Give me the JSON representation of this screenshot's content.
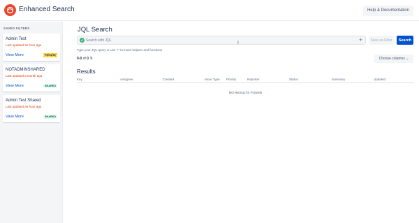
{
  "header": {
    "app_title": "Enhanced Search",
    "help_label": "Help & Documentation"
  },
  "sidebar": {
    "title": "SAVED FILTERS",
    "filters": [
      {
        "name": "Admin Test",
        "updated": "Last updated an hour ago",
        "link": "View More",
        "badge": "PRIVATE"
      },
      {
        "name": "NOTADMINSHARED",
        "updated": "Last updated a month ago",
        "link": "View More",
        "badge": "SHARED"
      },
      {
        "name": "Admin Test Shared",
        "updated": "Last updated an hour ago",
        "link": "View More",
        "badge": "SHARED"
      }
    ]
  },
  "main": {
    "title": "JQL Search",
    "jql": {
      "value": "",
      "placeholder": "Search with JQL"
    },
    "save_filter_label": "Save as Filter",
    "search_label": "Search",
    "helper_text": "Type your JQL query or use '+' to insert helpers and functions",
    "count": {
      "range": "0-0",
      "of": "of",
      "total": "0"
    },
    "choose_columns_label": "Choose columns",
    "results_title": "Results",
    "columns": [
      "Key",
      "Assignee",
      "Created",
      "Issue Type",
      "Priority",
      "Reporter",
      "Status",
      "Summary",
      "Updated"
    ],
    "no_results": "NO RESULTS FOUND"
  },
  "colors": {
    "brand": "#e8472d",
    "primary": "#0052cc",
    "danger_text": "#de350b",
    "jql_icon": "#36b37e"
  },
  "icons": {
    "logo": "enhanced-search-logo",
    "jql": "jql-check-icon",
    "add": "plus-icon",
    "refresh": "refresh-icon",
    "dropdown": "chevron-down-icon"
  }
}
